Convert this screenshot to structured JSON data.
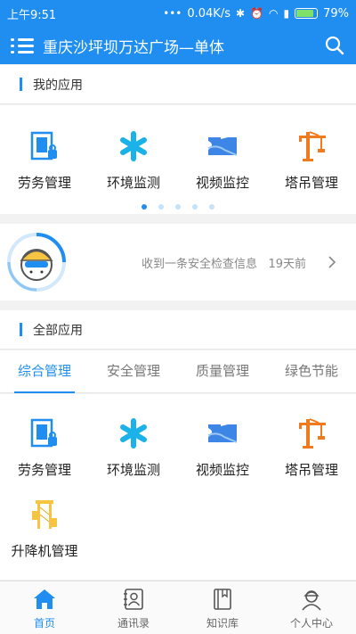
{
  "status_bar": {
    "time": "上午9:51",
    "speed": "0.04K/s",
    "battery": "79%"
  },
  "app_bar": {
    "title": "重庆沙坪坝万达广场—单体"
  },
  "my_apps": {
    "title": "我的应用",
    "items": [
      {
        "label": "劳务管理",
        "icon": "labor-icon"
      },
      {
        "label": "环境监测",
        "icon": "environment-icon"
      },
      {
        "label": "视频监控",
        "icon": "video-icon"
      },
      {
        "label": "塔吊管理",
        "icon": "tower-crane-icon"
      }
    ],
    "page_count": 5,
    "active_page": 1
  },
  "notice": {
    "message": "收到一条安全检查信息",
    "time": "19天前"
  },
  "all_apps": {
    "title": "全部应用",
    "tabs": [
      "综合管理",
      "安全管理",
      "质量管理",
      "绿色节能"
    ],
    "active_tab": 0,
    "items": [
      {
        "label": "劳务管理",
        "icon": "labor-icon"
      },
      {
        "label": "环境监测",
        "icon": "environment-icon"
      },
      {
        "label": "视频监控",
        "icon": "video-icon"
      },
      {
        "label": "塔吊管理",
        "icon": "tower-crane-icon"
      },
      {
        "label": "升降机管理",
        "icon": "elevator-icon"
      }
    ]
  },
  "bottom_nav": [
    {
      "label": "首页",
      "icon": "home-icon",
      "active": true
    },
    {
      "label": "通讯录",
      "icon": "contacts-icon",
      "active": false
    },
    {
      "label": "知识库",
      "icon": "knowledge-icon",
      "active": false
    },
    {
      "label": "个人中心",
      "icon": "profile-icon",
      "active": false
    }
  ],
  "colors": {
    "primary": "#1f8ef0",
    "orange": "#f07a1e",
    "yellow": "#f5c542"
  }
}
